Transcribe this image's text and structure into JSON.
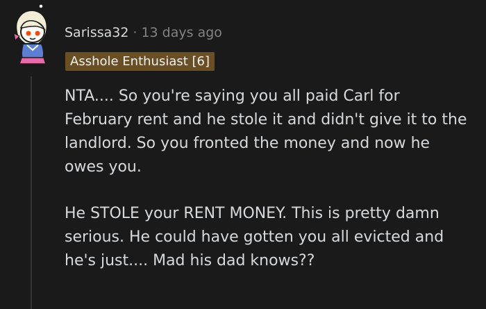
{
  "comment": {
    "username": "Sarissa32",
    "separator": "·",
    "timestamp": "13 days ago",
    "flair": "Asshole Enthusiast [6]",
    "paragraphs": [
      "NTA.... So you're saying you all paid Carl for February rent and he stole it and didn't give it to the landlord. So you fronted the money and now he owes you.",
      "He STOLE your RENT MONEY. This is pretty damn serious. He could have gotten you all evicted and he's just.... Mad his dad knows??"
    ]
  },
  "colors": {
    "background": "#1a1a1b",
    "text": "#d7dadc",
    "meta_text": "#818384",
    "flair_background": "#6b4f24",
    "thread_line": "#343536"
  }
}
